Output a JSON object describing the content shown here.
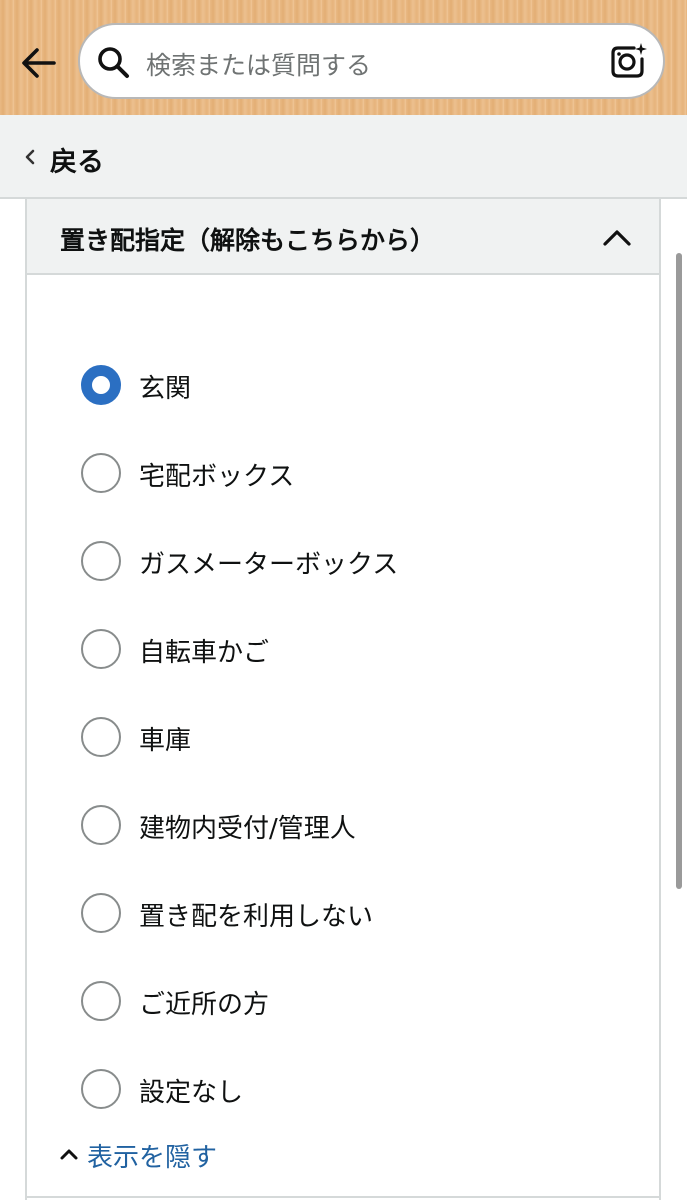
{
  "header": {
    "search_placeholder": "検索または質問する",
    "accent_color": "#e9b984"
  },
  "nav": {
    "back_label": "戻る"
  },
  "section": {
    "title": "置き配指定（解除もこちらから）",
    "selected_color": "#2b6fc2",
    "options": [
      {
        "label": "玄関",
        "selected": true
      },
      {
        "label": "宅配ボックス",
        "selected": false
      },
      {
        "label": "ガスメーターボックス",
        "selected": false
      },
      {
        "label": "自転車かご",
        "selected": false
      },
      {
        "label": "車庫",
        "selected": false
      },
      {
        "label": "建物内受付/管理人",
        "selected": false
      },
      {
        "label": "置き配を利用しない",
        "selected": false
      },
      {
        "label": "ご近所の方",
        "selected": false
      },
      {
        "label": "設定なし",
        "selected": false
      }
    ],
    "hide_label": "表示を隠す",
    "link_color": "#2162a1"
  }
}
